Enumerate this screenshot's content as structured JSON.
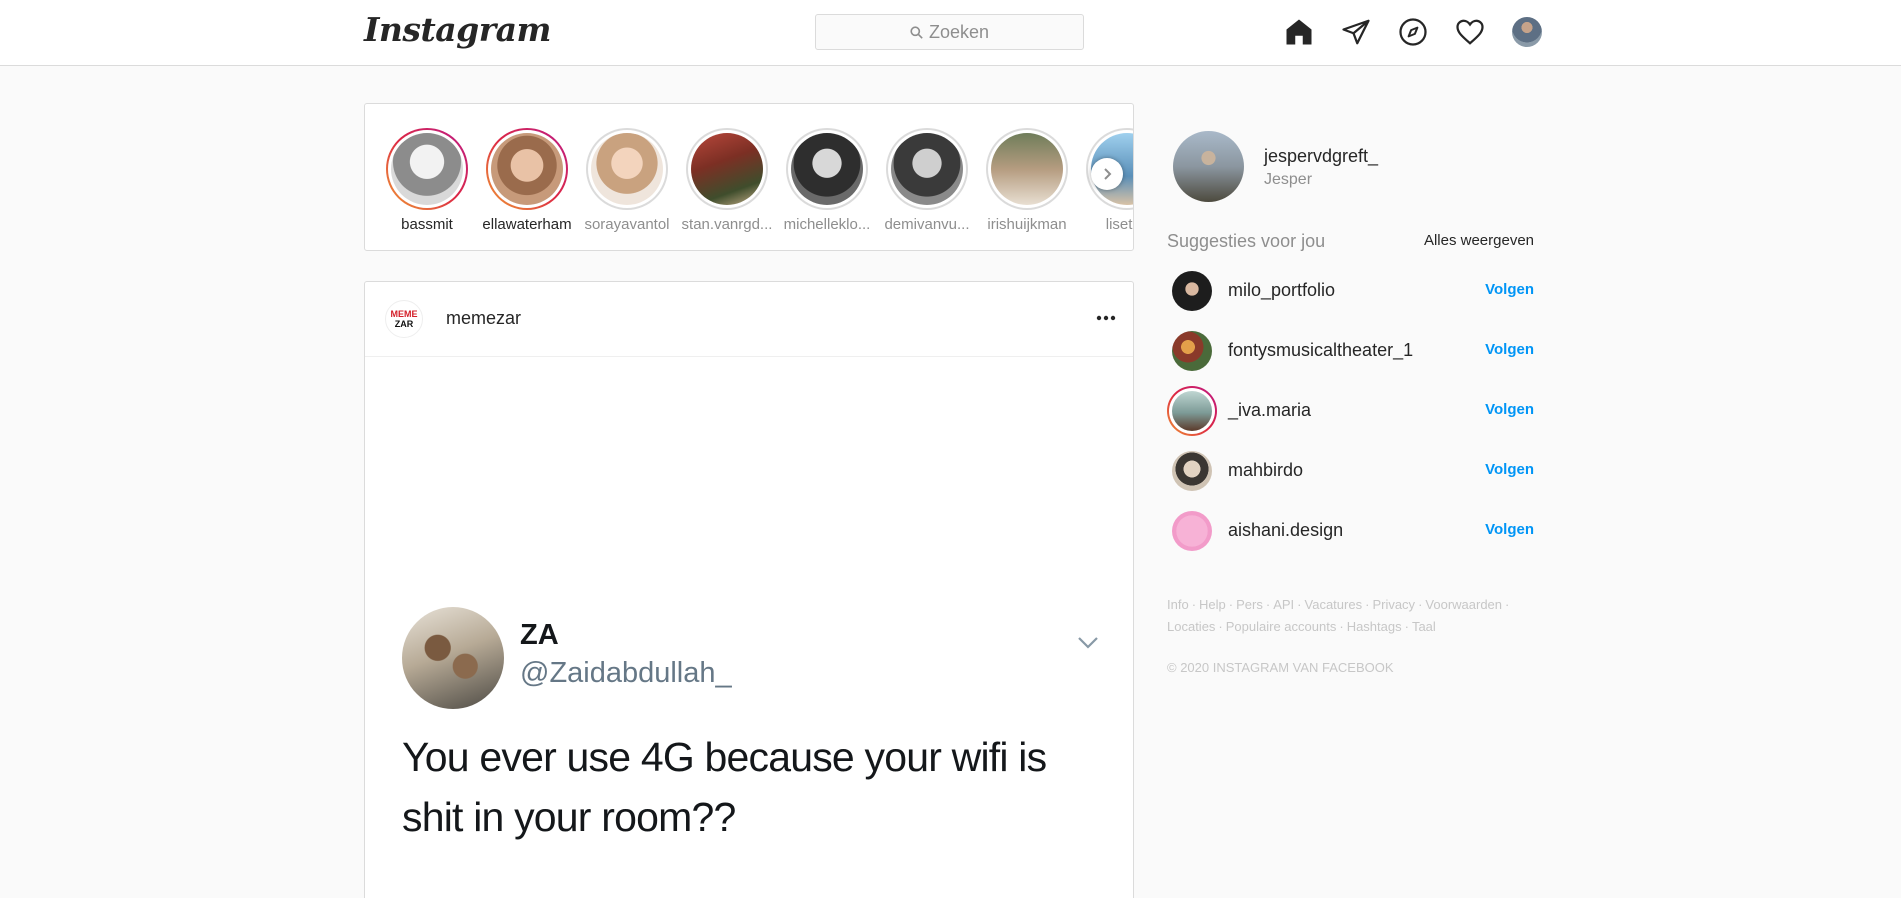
{
  "brand": {
    "logo_text": "Instagram"
  },
  "search": {
    "placeholder": "Zoeken"
  },
  "nav": {
    "icons": [
      "home-icon",
      "direct-message-icon",
      "explore-compass-icon",
      "activity-heart-icon",
      "profile-avatar"
    ]
  },
  "stories": [
    {
      "username": "bassmit",
      "seen": false,
      "color": "#d9d9d9"
    },
    {
      "username": "ellawaterham",
      "seen": false,
      "color": "#c79a7a"
    },
    {
      "username": "sorayavantol",
      "seen": true,
      "color": "#e2c2a4"
    },
    {
      "username": "stan.vanrgd...",
      "seen": true,
      "color": "#8a4a3a"
    },
    {
      "username": "michelleklo...",
      "seen": true,
      "color": "#3a3a3a"
    },
    {
      "username": "demivanvu...",
      "seen": true,
      "color": "#444444"
    },
    {
      "username": "irishuijkman",
      "seen": true,
      "color": "#8c7a62"
    },
    {
      "username": "lisetdc",
      "seen": true,
      "color": "#7fb6d8"
    }
  ],
  "post": {
    "username": "memezar",
    "avatar_text_top": "MEME",
    "avatar_text_bottom": "ZAR",
    "tweet": {
      "name": "ZA",
      "handle": "@Zaidabdullah_",
      "text": "You ever use 4G because your wifi is shit in your room??"
    }
  },
  "sidebar": {
    "me": {
      "username": "jespervdgreft_",
      "fullname": "Jesper"
    },
    "suggestions_title": "Suggesties voor jou",
    "see_all": "Alles weergeven",
    "follow_label": "Volgen",
    "suggestions": [
      {
        "username": "milo_portfolio",
        "ring": false,
        "color": "#1d1d1d"
      },
      {
        "username": "fontysmusicaltheater_1",
        "ring": false,
        "color": "#b0683c"
      },
      {
        "username": "_iva.maria",
        "ring": true,
        "color": "#7c9a96"
      },
      {
        "username": "mahbirdo",
        "ring": false,
        "color": "#cfc3b4"
      },
      {
        "username": "aishani.design",
        "ring": false,
        "color": "#f29bc9"
      }
    ],
    "footer_links": [
      "Info",
      "Help",
      "Pers",
      "API",
      "Vacatures",
      "Privacy",
      "Voorwaarden",
      "Locaties",
      "Populaire accounts",
      "Hashtags",
      "Taal"
    ],
    "copyright": "© 2020 INSTAGRAM VAN FACEBOOK"
  },
  "colors": {
    "accent_blue": "#0095f6",
    "story_gradient_start": "#f09433",
    "story_gradient_end": "#bc1888",
    "border": "#dbdbdb",
    "background": "#fafafa"
  }
}
